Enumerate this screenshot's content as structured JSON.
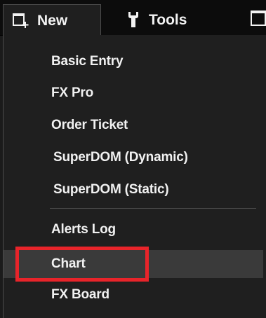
{
  "menubar": {
    "new_label": "New",
    "tools_label": "Tools",
    "new_icon": "new-window-icon",
    "tools_icon": "wrench-icon",
    "partial_icon": "window-icon"
  },
  "dropdown": {
    "items": [
      {
        "label": "Basic Entry"
      },
      {
        "label": "FX Pro"
      },
      {
        "label": "Order Ticket"
      },
      {
        "label": "SuperDOM (Dynamic)"
      },
      {
        "label": "SuperDOM (Static)"
      },
      {
        "label": "Alerts Log"
      },
      {
        "label": "Chart",
        "highlighted": true
      },
      {
        "label": "FX Board"
      }
    ]
  },
  "colors": {
    "menu_background": "#1f1f1f",
    "bar_background": "#0c0c0c",
    "text": "#f1f1f1",
    "hover": "#3a3a3a",
    "annotation_red": "#e8242a"
  }
}
